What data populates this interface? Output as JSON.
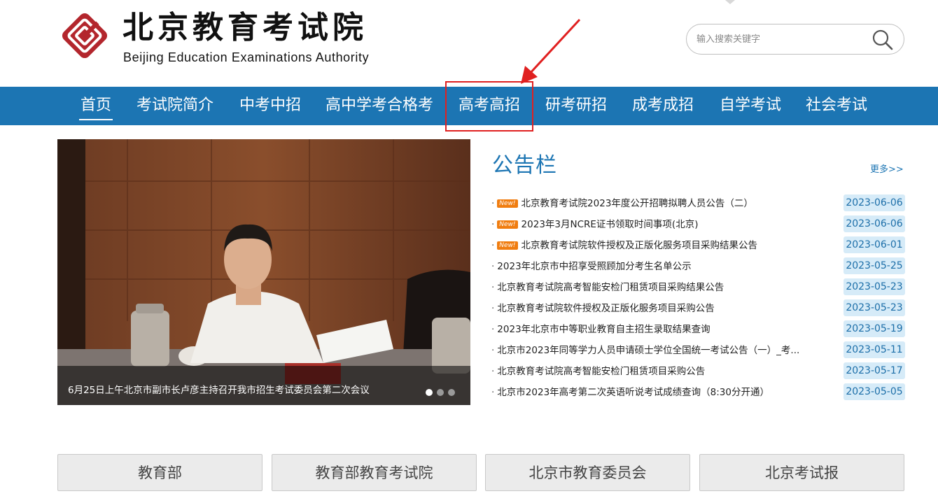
{
  "header": {
    "logo_cn": "北京教育考试院",
    "logo_en": "Beijing Education Examinations Authority",
    "logo_icon": "beaa-logo-icon",
    "search_placeholder": "输入搜索关键字",
    "search_icon": "search-icon"
  },
  "nav": {
    "items": [
      {
        "label": "首页",
        "active": true
      },
      {
        "label": "考试院简介"
      },
      {
        "label": "中考中招"
      },
      {
        "label": "高中学考合格考"
      },
      {
        "label": "高考高招",
        "highlighted": true
      },
      {
        "label": "研考研招"
      },
      {
        "label": "成考成招"
      },
      {
        "label": "自学考试"
      },
      {
        "label": "社会考试"
      }
    ]
  },
  "slideshow": {
    "caption": "6月25日上午北京市副市长卢彦主持召开我市招生考试委员会第二次会议",
    "dots": 3,
    "active_dot": 1
  },
  "notice": {
    "title": "公告栏",
    "more": "更多>>",
    "new_label": "New!",
    "items": [
      {
        "title": "北京教育考试院2023年度公开招聘拟聘人员公告（二）",
        "date": "2023-06-06",
        "is_new": true
      },
      {
        "title": "2023年3月NCRE证书领取时间事项(北京)",
        "date": "2023-06-06",
        "is_new": true
      },
      {
        "title": "北京教育考试院软件授权及正版化服务项目采购结果公告",
        "date": "2023-06-01",
        "is_new": true
      },
      {
        "title": "2023年北京市中招享受照顾加分考生名单公示",
        "date": "2023-05-25",
        "is_new": false
      },
      {
        "title": "北京教育考试院高考智能安检门租赁项目采购结果公告",
        "date": "2023-05-23",
        "is_new": false
      },
      {
        "title": "北京教育考试院软件授权及正版化服务项目采购公告",
        "date": "2023-05-23",
        "is_new": false
      },
      {
        "title": "2023年北京市中等职业教育自主招生录取结果查询",
        "date": "2023-05-19",
        "is_new": false
      },
      {
        "title": "北京市2023年同等学力人员申请硕士学位全国统一考试公告（一）_考...",
        "date": "2023-05-11",
        "is_new": false
      },
      {
        "title": "北京教育考试院高考智能安检门租赁项目采购公告",
        "date": "2023-05-17",
        "is_new": false
      },
      {
        "title": "北京市2023年高考第二次英语听说考试成绩查询（8:30分开通）",
        "date": "2023-05-05",
        "is_new": false
      }
    ]
  },
  "links": [
    {
      "label": "教育部"
    },
    {
      "label": "教育部教育考试院"
    },
    {
      "label": "北京市教育委员会"
    },
    {
      "label": "北京考试报"
    }
  ],
  "colors": {
    "brand_blue": "#1c75b3",
    "highlight_red": "#e02020",
    "badge_orange": "#f07d10",
    "date_bg": "#d6ebf8",
    "logo_red": "#b3262d"
  }
}
